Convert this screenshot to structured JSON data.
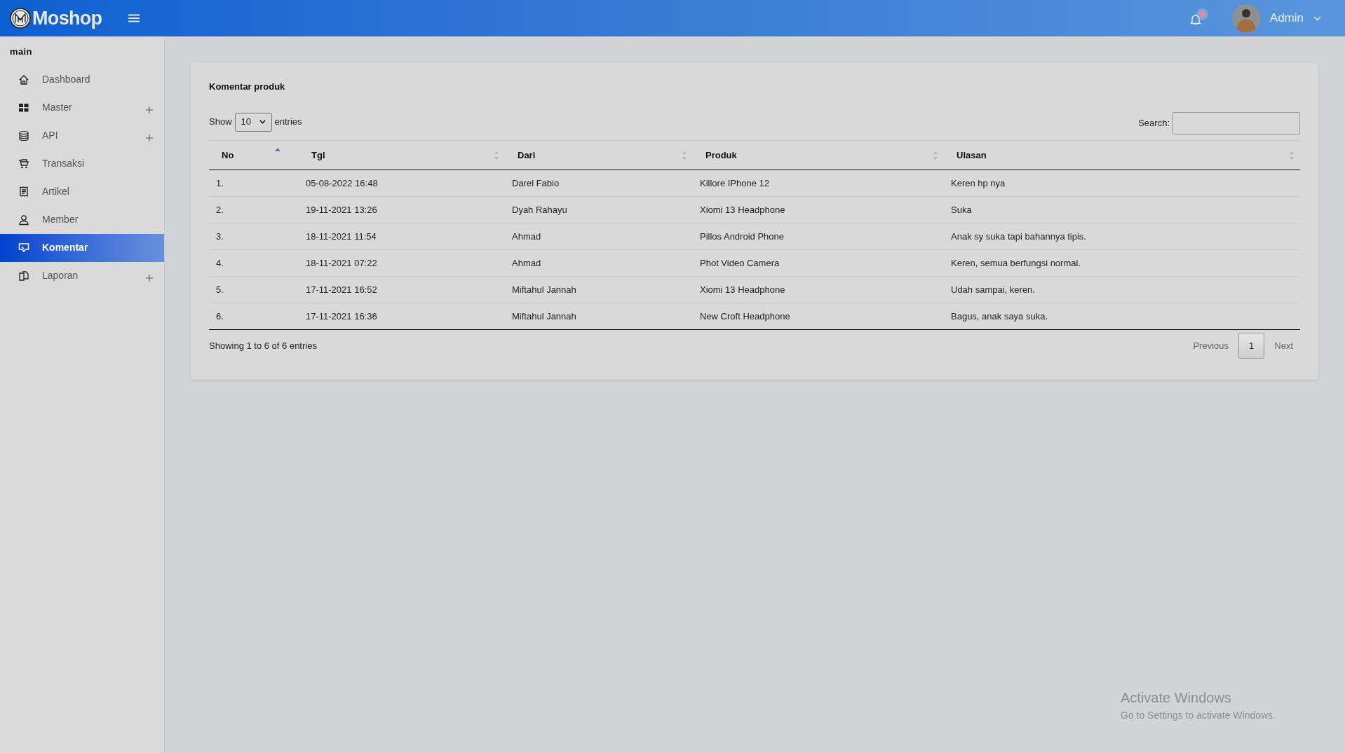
{
  "header": {
    "brand": "Moshop",
    "notifications": {
      "unread": true
    },
    "user": {
      "name": "Admin"
    }
  },
  "sidebar": {
    "section": "main",
    "items": [
      {
        "label": "Dashboard",
        "expandable": false,
        "selected": false
      },
      {
        "label": "Master",
        "expandable": true,
        "selected": false
      },
      {
        "label": "API",
        "expandable": true,
        "selected": false
      },
      {
        "label": "Transaksi",
        "expandable": false,
        "selected": false
      },
      {
        "label": "Artikel",
        "expandable": false,
        "selected": false
      },
      {
        "label": "Member",
        "expandable": false,
        "selected": false
      },
      {
        "label": "Komentar",
        "expandable": false,
        "selected": true
      },
      {
        "label": "Laporan",
        "expandable": true,
        "selected": false
      }
    ]
  },
  "card": {
    "title": "Komentar produk",
    "length": {
      "before": "Show",
      "value": "10",
      "after": "entries"
    },
    "search": {
      "label": "Search:"
    },
    "table": {
      "columns": [
        {
          "label": "No",
          "sorted": true
        },
        {
          "label": "Tgl",
          "sorted": false
        },
        {
          "label": "Dari",
          "sorted": false
        },
        {
          "label": "Produk",
          "sorted": false
        },
        {
          "label": "Ulasan",
          "sorted": false
        }
      ],
      "rows": [
        [
          "1.",
          "05-08-2022 16:48",
          "Darel Fabio",
          "Killore IPhone 12",
          "Keren hp nya"
        ],
        [
          "2.",
          "19-11-2021 13:26",
          "Dyah Rahayu",
          "Xiomi 13 Headphone",
          "Suka"
        ],
        [
          "3.",
          "18-11-2021 11:54",
          "Ahmad",
          "Pillos Android Phone",
          "Anak sy suka tapi bahannya tipis."
        ],
        [
          "4.",
          "18-11-2021 07:22",
          "Ahmad",
          "Phot Video Camera",
          "Keren, semua berfungsi normal."
        ],
        [
          "5.",
          "17-11-2021 16:52",
          "Miftahul Jannah",
          "Xiomi 13 Headphone",
          "Udah sampai, keren."
        ],
        [
          "6.",
          "17-11-2021 16:36",
          "Miftahul Jannah",
          "New Croft Headphone",
          "Bagus, anak saya suka."
        ]
      ]
    },
    "info": "Showing 1 to 6 of 6 entries",
    "pagination": [
      {
        "label": "Previous",
        "kind": "nav",
        "disabled": true,
        "selected": false
      },
      {
        "label": "1",
        "kind": "page",
        "disabled": false,
        "selected": true
      },
      {
        "label": "Next",
        "kind": "nav",
        "disabled": true,
        "selected": false
      }
    ]
  },
  "os_notice": {
    "title": "Activate Windows",
    "subtitle": "Go to Settings to activate Windows."
  }
}
